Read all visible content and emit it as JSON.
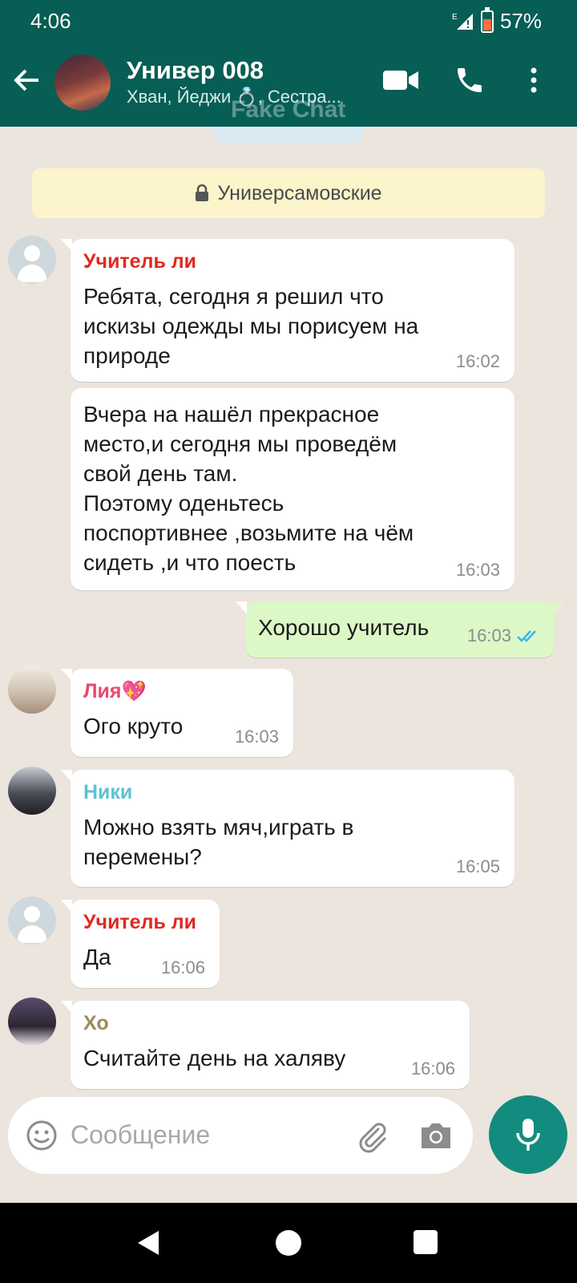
{
  "status_bar": {
    "time": "4:06",
    "network": "E",
    "battery": "57%",
    "battery_level": 0.57
  },
  "header": {
    "title": "Универ 008",
    "subtitle": "Хван, Йеджи 💍, Сестра...",
    "watermark": "Fake Chat",
    "icons": [
      "back-arrow-icon",
      "video-call-icon",
      "phone-call-icon",
      "more-options-icon"
    ]
  },
  "system_message": {
    "text": "Универсамовские",
    "icon": "lock-icon"
  },
  "messages": [
    {
      "sender": "Учитель ли",
      "sender_color": "#e0281f",
      "text": "Ребята, сегодня я решил что\nискизы одежды мы порисуем на\nприроде",
      "time": "16:02"
    },
    {
      "sender": "",
      "text": "Вчера на нашёл прекрасное\nместо,и сегодня мы проведём\nсвой день там.\nПоэтому оденьтесь\nпоспортивнее ,возьмите на чём\nсидеть ,и что поесть",
      "time": "16:03"
    },
    {
      "outgoing": true,
      "text": "Хорошо учитель",
      "time": "16:03",
      "status": "read"
    },
    {
      "sender": "Лия💖",
      "sender_color": "#e84a6f",
      "text": "Ого круто",
      "time": "16:03"
    },
    {
      "sender": "Ники",
      "sender_color": "#5bc4d1",
      "text": "Можно взять мяч,играть в\nперемены?",
      "time": "16:05"
    },
    {
      "sender": "Учитель ли",
      "sender_color": "#e0281f",
      "text": "Да",
      "time": "16:06"
    },
    {
      "sender": "Хо",
      "sender_color": "#9c8a5a",
      "text": "Считайте день на халяву",
      "time": "16:06"
    }
  ],
  "composer": {
    "placeholder": "Сообщение"
  },
  "colors": {
    "header": "#075e54",
    "outgoing_bubble": "#dcf8c6",
    "read_ticks": "#34b7f1",
    "mic_button": "#128c7e"
  }
}
